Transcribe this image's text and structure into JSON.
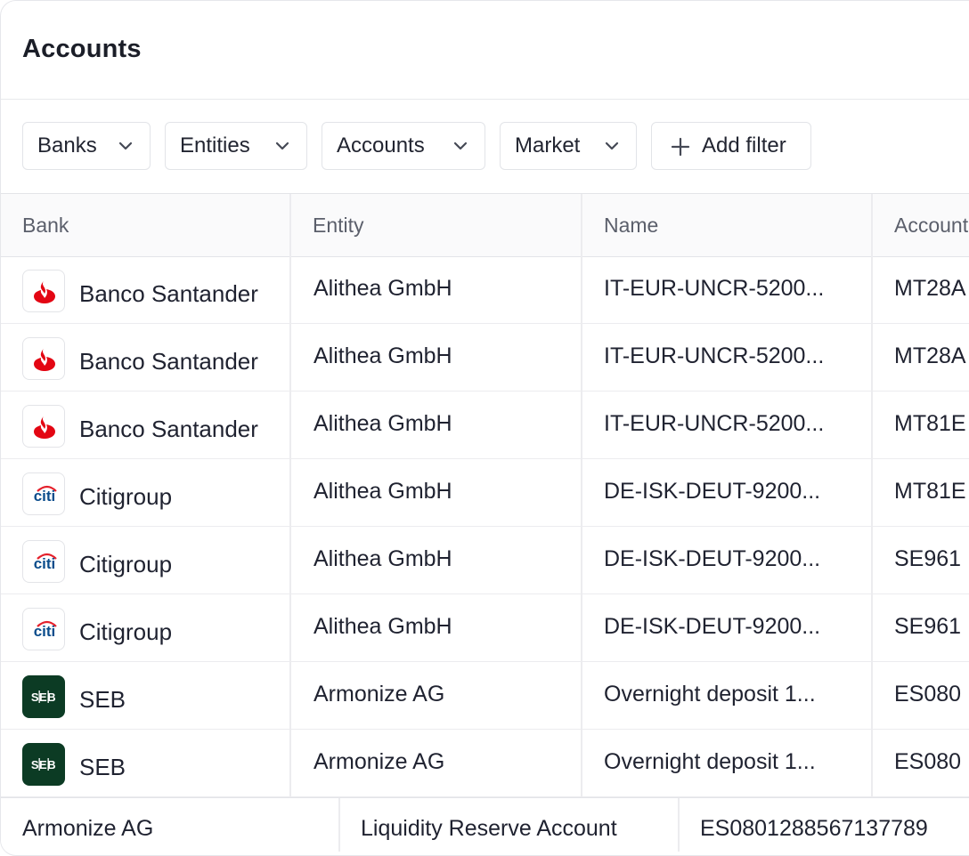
{
  "page": {
    "title": "Accounts"
  },
  "filters": [
    {
      "label": "Banks",
      "icon": "chevron-down-icon"
    },
    {
      "label": "Entities",
      "icon": "chevron-down-icon"
    },
    {
      "label": "Accounts",
      "icon": "chevron-down-icon"
    },
    {
      "label": "Market",
      "icon": "chevron-down-icon"
    },
    {
      "label": "Add filter",
      "icon": "plus-icon"
    }
  ],
  "table": {
    "columns": [
      "Bank",
      "Entity",
      "Name",
      "Account"
    ],
    "rows": [
      {
        "bank": "Banco Santander",
        "logo": "santander-logo-icon",
        "entity": "Alithea GmbH",
        "name": "IT-EUR-UNCR-5200...",
        "account": "MT28A"
      },
      {
        "bank": "Banco Santander",
        "logo": "santander-logo-icon",
        "entity": "Alithea GmbH",
        "name": "IT-EUR-UNCR-5200...",
        "account": "MT28A"
      },
      {
        "bank": "Banco Santander",
        "logo": "santander-logo-icon",
        "entity": "Alithea GmbH",
        "name": "IT-EUR-UNCR-5200...",
        "account": "MT81E"
      },
      {
        "bank": "Citigroup",
        "logo": "citi-logo-icon",
        "entity": "Alithea GmbH",
        "name": "DE-ISK-DEUT-9200...",
        "account": "MT81E"
      },
      {
        "bank": "Citigroup",
        "logo": "citi-logo-icon",
        "entity": "Alithea GmbH",
        "name": "DE-ISK-DEUT-9200...",
        "account": "SE961"
      },
      {
        "bank": "Citigroup",
        "logo": "citi-logo-icon",
        "entity": "Alithea GmbH",
        "name": "DE-ISK-DEUT-9200...",
        "account": "SE961"
      },
      {
        "bank": "SEB",
        "logo": "seb-logo-icon",
        "entity": "Armonize AG",
        "name": "Overnight deposit 1...",
        "account": "ES080"
      },
      {
        "bank": "SEB",
        "logo": "seb-logo-icon",
        "entity": "Armonize AG",
        "name": "Overnight deposit 1...",
        "account": "ES080"
      }
    ],
    "overflow_row": {
      "entity": "Armonize AG",
      "name": "Liquidity Reserve Account",
      "account": "ES0801288567137789"
    }
  },
  "logos": {
    "santander": {
      "text": "",
      "color": "#e30613"
    },
    "citi": {
      "text": "citi",
      "color": "#0b4d8c",
      "arc": "#e4202b"
    },
    "seb": {
      "text": "SEB",
      "bg": "#0c3b24"
    }
  }
}
